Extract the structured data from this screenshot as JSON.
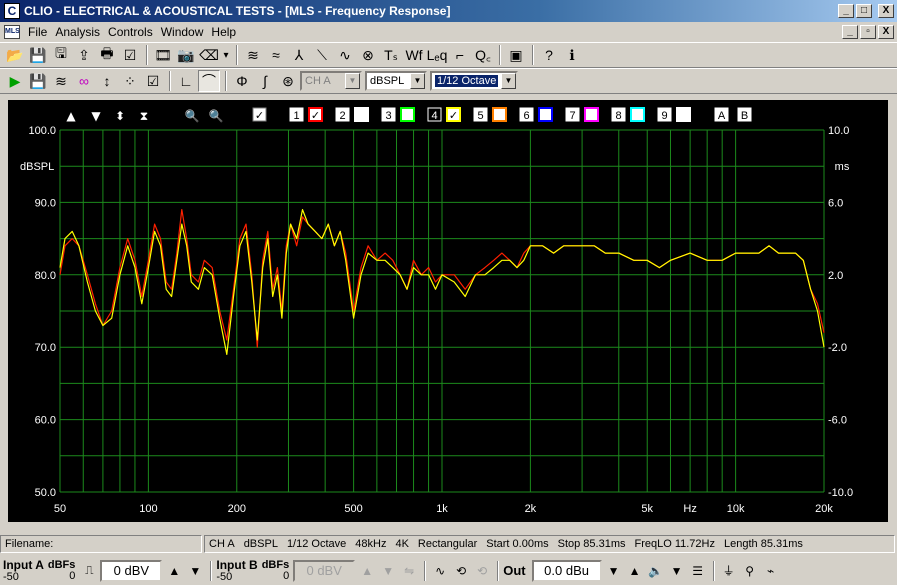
{
  "window": {
    "title": "CLIO - ELECTRICAL & ACOUSTICAL TESTS - [MLS - Frequency Response]",
    "app_icon_letter": "C",
    "doc_icon_label": "MLS",
    "min_glyph": "_",
    "max_glyph": "□",
    "close_glyph": "X",
    "mdi_min_glyph": "_",
    "mdi_restore_glyph": "▫",
    "mdi_close_glyph": "X"
  },
  "menu": {
    "items": [
      "File",
      "Analysis",
      "Controls",
      "Window",
      "Help"
    ]
  },
  "toolbar1": {
    "icons": [
      "open-folder-icon",
      "save-icon",
      "save-as-icon",
      "export-icon",
      "print-icon",
      "notes-icon",
      "scope-icon",
      "camera-icon",
      "eraser-icon",
      "dropdown-icon",
      "waveform-icon",
      "spectrum-icon",
      "impulse-icon",
      "step-icon",
      "sine-icon",
      "multimeter-icon",
      "ts-icon",
      "wf-icon",
      "leq-icon",
      "staircase-icon",
      "qc-icon",
      "monitor-icon",
      "help-icon",
      "info-icon"
    ],
    "glyphs": [
      "📂",
      "💾",
      "🖫",
      "⇪",
      "🖶",
      "☑",
      "🎞",
      "📷",
      "⌫",
      "▾",
      "≋",
      "≈",
      "⅄",
      "⟍",
      "∿",
      "⊗",
      "Tₛ",
      "Wf",
      "Lₑq",
      "⌐",
      "Q꜀",
      "▣",
      "?",
      "ℹ"
    ]
  },
  "toolbar2": {
    "glyphs": [
      "▶",
      "💾",
      "≋",
      "∞",
      "↕",
      "⁘",
      "☑",
      "∟",
      "⌒",
      "Φ",
      "∫",
      "⊛"
    ],
    "channel": "CH A",
    "units": "dBSPL",
    "smoothing": "1/12 Octave"
  },
  "graph": {
    "left_axis_unit": "dBSPL",
    "right_axis_unit": "ms",
    "x_unit": "Hz",
    "overlay_numbers": [
      "1",
      "2",
      "3",
      "4",
      "5",
      "6",
      "7",
      "8",
      "9"
    ],
    "overlay_colors": [
      "#ff0000",
      "#ffffff",
      "#00ff00",
      "#ffff00",
      "#ff8000",
      "#0000ff",
      "#ff00ff",
      "#00ffff",
      "#ffffff"
    ],
    "overlay_checked": [
      true,
      false,
      false,
      true,
      false,
      false,
      false,
      false,
      false
    ],
    "letters": [
      "A",
      "B"
    ],
    "nav_glyphs": [
      "▲",
      "▼",
      "⬍",
      "⧗",
      "🔍",
      "🔍"
    ]
  },
  "chart_data": {
    "type": "line",
    "xscale": "log",
    "xlim": [
      50,
      20000
    ],
    "ylim": [
      50,
      100
    ],
    "ylim_right": [
      -10,
      10
    ],
    "x_ticks": [
      50,
      100,
      200,
      500,
      1000,
      2000,
      5000,
      10000,
      20000
    ],
    "x_tick_labels": [
      "50",
      "100",
      "200",
      "500",
      "1k",
      "2k",
      "5k",
      "10k",
      "20k"
    ],
    "y_ticks": [
      50,
      60,
      70,
      80,
      90,
      100
    ],
    "y_tick_labels": [
      "50.0",
      "60.0",
      "70.0",
      "80.0",
      "90.0",
      "100.0"
    ],
    "y_right_tick_labels": [
      "-10.0",
      "-6.0",
      "-2.0",
      "2.0",
      "6.0",
      "10.0"
    ],
    "ylabel": "dBSPL",
    "ylabel_right": "ms",
    "xlabel": "Hz",
    "series": [
      {
        "color": "#ff2000",
        "x": [
          50,
          52,
          55,
          58,
          62,
          66,
          70,
          75,
          80,
          85,
          90,
          95,
          100,
          105,
          110,
          115,
          120,
          125,
          130,
          135,
          140,
          148,
          155,
          165,
          175,
          185,
          195,
          205,
          215,
          225,
          235,
          245,
          255,
          265,
          275,
          285,
          295,
          305,
          320,
          335,
          350,
          370,
          390,
          410,
          430,
          450,
          470,
          500,
          530,
          560,
          600,
          640,
          680,
          720,
          760,
          800,
          850,
          900,
          950,
          1000,
          1100,
          1200,
          1300,
          1400,
          1500,
          1600,
          1700,
          1800,
          1900,
          2000,
          2200,
          2400,
          2600,
          2800,
          3000,
          3300,
          3600,
          4000,
          4500,
          5000,
          5500,
          6000,
          7000,
          8000,
          9000,
          10000,
          11000,
          12000,
          13000,
          14000,
          15000,
          16000,
          17000,
          18000,
          19000,
          20000
        ],
        "y": [
          80,
          84,
          85,
          84,
          80,
          76,
          73,
          75,
          81,
          85,
          82,
          77,
          82,
          87,
          85,
          79,
          78,
          83,
          89,
          85,
          80,
          79,
          82,
          81,
          75,
          71,
          78,
          85,
          87,
          80,
          70,
          82,
          86,
          78,
          81,
          75,
          84,
          87,
          84,
          88,
          87,
          86,
          85,
          87,
          84,
          86,
          83,
          75,
          81,
          84,
          82,
          83,
          82,
          80,
          78,
          82,
          80,
          81,
          79,
          80,
          80,
          78,
          80,
          81,
          82,
          83,
          82,
          81,
          83,
          84,
          84,
          83,
          84,
          84,
          84,
          84,
          83,
          83,
          82,
          82,
          81,
          82,
          83,
          82,
          82,
          83,
          83,
          83,
          84,
          83,
          83,
          83,
          82,
          78,
          76,
          72
        ]
      },
      {
        "color": "#ffff00",
        "x": [
          50,
          52,
          55,
          58,
          62,
          66,
          70,
          75,
          80,
          85,
          90,
          95,
          100,
          105,
          110,
          115,
          120,
          125,
          130,
          135,
          140,
          148,
          155,
          165,
          175,
          185,
          195,
          205,
          215,
          225,
          235,
          245,
          255,
          265,
          275,
          285,
          295,
          305,
          320,
          335,
          350,
          370,
          390,
          410,
          430,
          450,
          470,
          500,
          530,
          560,
          600,
          640,
          680,
          720,
          760,
          800,
          850,
          900,
          950,
          1000,
          1100,
          1200,
          1300,
          1400,
          1500,
          1600,
          1700,
          1800,
          1900,
          2000,
          2200,
          2400,
          2600,
          2800,
          3000,
          3300,
          3600,
          4000,
          4500,
          5000,
          5500,
          6000,
          7000,
          8000,
          9000,
          10000,
          11000,
          12000,
          13000,
          14000,
          15000,
          16000,
          17000,
          18000,
          19000,
          20000
        ],
        "y": [
          81,
          85,
          86,
          84,
          79,
          75,
          73,
          74,
          80,
          84,
          81,
          76,
          81,
          86,
          84,
          78,
          77,
          82,
          87,
          84,
          79,
          78,
          81,
          80,
          74,
          69,
          77,
          84,
          86,
          79,
          71,
          81,
          85,
          77,
          80,
          74,
          83,
          87,
          85,
          89,
          87,
          86,
          85,
          87,
          84,
          86,
          82,
          74,
          80,
          83,
          82,
          82,
          81,
          80,
          78,
          81,
          80,
          80,
          78,
          80,
          79,
          77,
          80,
          80,
          81,
          82,
          82,
          81,
          82,
          84,
          84,
          83,
          84,
          84,
          84,
          84,
          83,
          83,
          82,
          82,
          81,
          82,
          83,
          82,
          82,
          83,
          83,
          83,
          84,
          83,
          83,
          83,
          82,
          78,
          75,
          70
        ]
      }
    ]
  },
  "status": {
    "filename_label": "Filename:",
    "channel": "CH A",
    "units": "dBSPL",
    "smoothing": "1/12 Octave",
    "rate": "48kHz",
    "size": "4K",
    "window": "Rectangular",
    "start": "Start 0.00ms",
    "stop": "Stop 85.31ms",
    "freqlo": "FreqLO 11.72Hz",
    "length": "Length 85.31ms"
  },
  "bottom": {
    "input_a_label": "Input A",
    "input_a_range": "-50",
    "input_a_zero": "0",
    "input_a_value": "0 dBV",
    "input_b_label": "Input B",
    "input_b_range": "-50",
    "input_b_zero": "0",
    "input_b_value": "0 dBV",
    "dbfs_label": "dBFs",
    "out_label": "Out",
    "out_value": "0.0 dBu"
  }
}
